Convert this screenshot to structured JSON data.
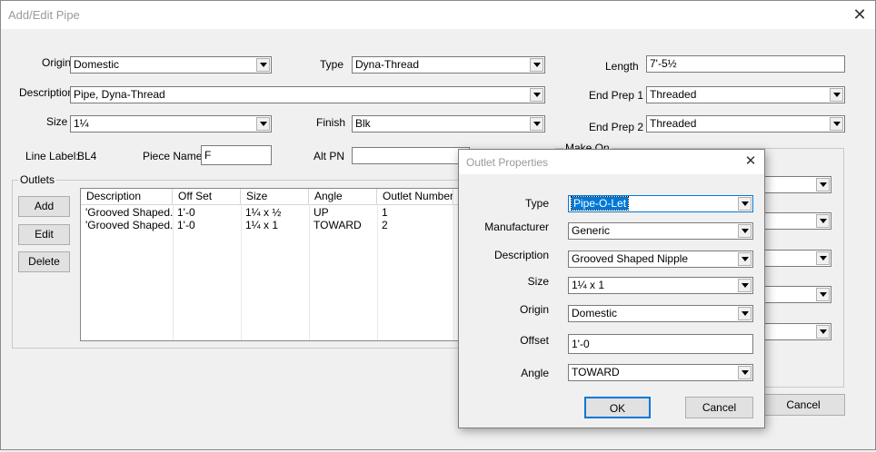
{
  "window": {
    "title": "Add/Edit Pipe",
    "close_glyph": "✕"
  },
  "form": {
    "origin_label": "Origin",
    "origin_value": "Domestic",
    "type_label": "Type",
    "type_value": "Dyna-Thread",
    "length_label": "Length",
    "length_value": "7'-5½",
    "description_label": "Description",
    "description_value": "Pipe, Dyna-Thread",
    "end_prep1_label": "End Prep 1",
    "end_prep1_value": "Threaded",
    "size_label": "Size",
    "size_value": "1¼",
    "finish_label": "Finish",
    "finish_value": "Blk",
    "end_prep2_label": "End Prep 2",
    "end_prep2_value": "Threaded",
    "line_label_label": "Line Label:",
    "line_label_value": "BL4",
    "piece_name_label": "Piece Name",
    "piece_name_value": "F",
    "alt_pn_label": "Alt PN",
    "alt_pn_value": "",
    "make_on_label": "Make On",
    "cancel_label": "Cancel"
  },
  "outlets": {
    "group_label": "Outlets",
    "add_label": "Add",
    "edit_label": "Edit",
    "delete_label": "Delete",
    "columns": [
      "Description",
      "Off Set",
      "Size",
      "Angle",
      "Outlet Number"
    ],
    "rows": [
      [
        "'Grooved Shaped...",
        "1'-0",
        "1¼ x ½",
        "UP",
        "1"
      ],
      [
        "'Grooved Shaped...",
        "1'-0",
        "1¼ x 1",
        "TOWARD",
        "2"
      ]
    ]
  },
  "dialog": {
    "title": "Outlet Properties",
    "close_glyph": "✕",
    "type_label": "Type",
    "type_value": "Pipe-O-Let",
    "manufacturer_label": "Manufacturer",
    "manufacturer_value": "Generic",
    "description_label": "Description",
    "description_value": "Grooved Shaped Nipple",
    "size_label": "Size",
    "size_value": "1¼ x 1",
    "origin_label": "Origin",
    "origin_value": "Domestic",
    "offset_label": "Offset",
    "offset_value": "1'-0",
    "angle_label": "Angle",
    "angle_value": "TOWARD",
    "ok_label": "OK",
    "cancel_label": "Cancel"
  },
  "colors": {
    "selection": "#0078d7",
    "window_bg": "#f0f0f0",
    "accent_border": "#0078d7"
  }
}
